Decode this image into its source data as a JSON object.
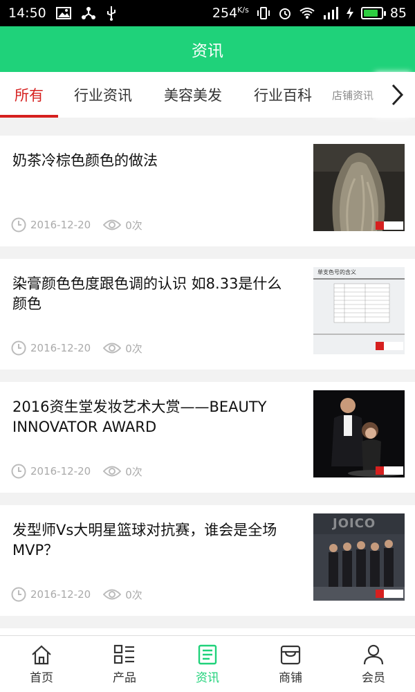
{
  "status_bar": {
    "time": "14:50",
    "speed": "254",
    "speed_unit": "K/s",
    "battery": "85",
    "battery_level": 0.85
  },
  "header": {
    "title": "资讯"
  },
  "tabs": [
    {
      "label": "所有",
      "active": true
    },
    {
      "label": "行业资讯",
      "active": false
    },
    {
      "label": "美容美发",
      "active": false
    },
    {
      "label": "行业百科",
      "active": false
    },
    {
      "label": "店铺资讯",
      "active": false
    }
  ],
  "articles": [
    {
      "title": "奶茶冷棕色颜色的做法",
      "date": "2016-12-20",
      "views": "0次",
      "thumb": "hair-photo"
    },
    {
      "title": "染膏颜色色度跟色调的认识 如8.33是什么颜色",
      "date": "2016-12-20",
      "views": "0次",
      "thumb": "color-chart-photo",
      "thumb_heading": "单支色号的含义"
    },
    {
      "title": "2016资生堂发妆艺术大赏——BEAUTY INNOVATOR AWARD",
      "date": "2016-12-20",
      "views": "0次",
      "thumb": "stage-photo"
    },
    {
      "title": "发型师Vs大明星篮球对抗赛，谁会是全场MVP？",
      "date": "2016-12-20",
      "views": "0次",
      "thumb": "team-photo",
      "thumb_banner": "JOICO"
    }
  ],
  "bottom_nav": [
    {
      "label": "首页",
      "icon": "home-icon",
      "active": false
    },
    {
      "label": "产品",
      "icon": "list-icon",
      "active": false
    },
    {
      "label": "资讯",
      "icon": "news-icon",
      "active": true
    },
    {
      "label": "商铺",
      "icon": "store-icon",
      "active": false
    },
    {
      "label": "会员",
      "icon": "user-icon",
      "active": false
    }
  ],
  "colors": {
    "brand": "#1fd27a",
    "accent": "#d6201f"
  }
}
